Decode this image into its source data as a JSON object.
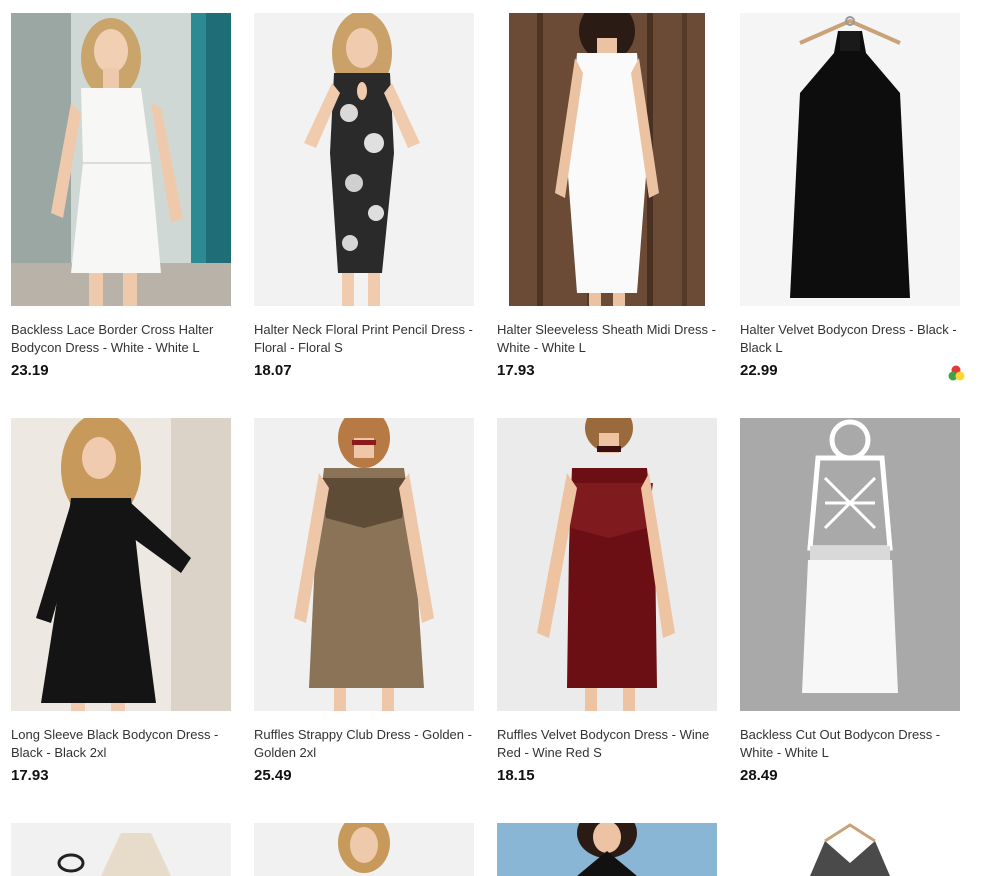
{
  "products": [
    {
      "title": "Backless Lace Border Cross Halter Bodycon Dress - White - White L",
      "price": "23.19",
      "image": "white-lace-dress-photo"
    },
    {
      "title": "Halter Neck Floral Print Pencil Dress - Floral - Floral S",
      "price": "18.07",
      "image": "floral-pencil-dress-photo"
    },
    {
      "title": "Halter Sleeveless Sheath Midi Dress - White - White L",
      "price": "17.93",
      "image": "white-sheath-dress-photo"
    },
    {
      "title": "Halter Velvet Bodycon Dress - Black - Black L",
      "price": "22.99",
      "image": "black-velvet-dress-photo",
      "has_color_swatch": true
    },
    {
      "title": "Long Sleeve Black Bodycon Dress - Black - Black 2xl",
      "price": "17.93",
      "image": "black-long-sleeve-dress-photo"
    },
    {
      "title": "Ruffles Strappy Club Dress - Golden - Golden 2xl",
      "price": "25.49",
      "image": "golden-ruffle-dress-photo"
    },
    {
      "title": "Ruffles Velvet Bodycon Dress - Wine Red - Wine Red S",
      "price": "18.15",
      "image": "wine-red-velvet-dress-photo"
    },
    {
      "title": "Backless Cut Out Bodycon Dress - White - White L",
      "price": "28.49",
      "image": "white-cutout-dress-photo"
    }
  ],
  "swatch_colors": [
    "#e53935",
    "#43a047",
    "#fdd835"
  ]
}
